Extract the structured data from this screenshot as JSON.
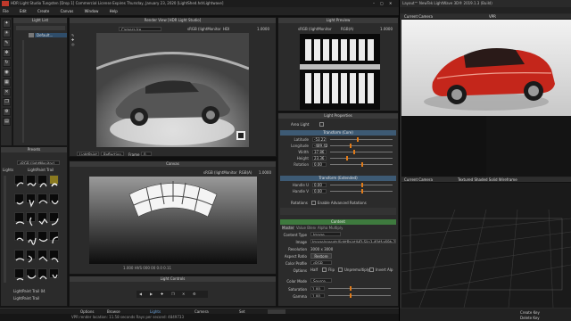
{
  "titlebar": {
    "title": "HDR Light Studio Tungsten [Drop 1] Commercial License Expires Thursday, January 23, 2020 [LightShed.hdrLightwave]"
  },
  "menubar": {
    "items": [
      "File",
      "Edit",
      "Create",
      "Canvas",
      "Window",
      "Help"
    ]
  },
  "light_list": {
    "title": "Light List",
    "row_label": "Default..."
  },
  "presets": {
    "title": "Presets",
    "tabs": [
      "Lights",
      "LightPaint Trail"
    ],
    "profile": "sRGB (lightMonitor)",
    "current": "LightPaint Trail 04",
    "footer": "LightPaint Trail"
  },
  "render_view": {
    "title": "Render View [HDR Light Studio]",
    "camera": "Camera.Ire",
    "cs": "sRGB (lightMonitor)",
    "mode": "HDI",
    "value": "1.0000",
    "tab": "LightPaint",
    "reflection": "Reflection",
    "frame_label": "Frame",
    "frame_value": "0"
  },
  "canvas": {
    "title": "Canvas",
    "cs": "sRGB (lightMonitor)",
    "mode": "RGB(A)",
    "value": "1.0000",
    "readout": "1.000  HVS 000 00 0.0 0.11",
    "controls_title": "Light Controls"
  },
  "preview": {
    "title": "Light Preview",
    "cs": "sRGB (lightMonitor)",
    "mode": "RGB(A)",
    "value": "1.0000"
  },
  "properties": {
    "title": "Light Properties",
    "area_light": "Area Light",
    "transform_title": "Transform (Core)",
    "core": [
      {
        "label": "Latitude",
        "value": "-53.22"
      },
      {
        "label": "Longitude",
        "value": "-489.42"
      },
      {
        "label": "Width",
        "value": "37.86"
      },
      {
        "label": "Height",
        "value": "23.36"
      },
      {
        "label": "Rotation",
        "value": "0.00"
      }
    ],
    "ext_title": "Transform (Extended)",
    "ext": [
      {
        "label": "Handle U",
        "value": "0.00"
      },
      {
        "label": "Handle V",
        "value": "0.00"
      }
    ],
    "rotations": "Rotations",
    "adv": "Enable Advanced Rotations",
    "content_title": "Content",
    "content_tabs": [
      "Master",
      "Value Blend",
      "Alpha Multiply"
    ],
    "content_type_label": "Content Type",
    "content_type": "Image",
    "image_label": "Image",
    "image_path": "Image/presets/lightPaint/HD-Silo3-40df-a69b-23f0ab4b90e6.f",
    "resolution_label": "Resolution",
    "resolution": "3000 x 3000",
    "aspect_label": "Aspect Ratio",
    "aspect_btn": "Restore",
    "profile_label": "Color Profile",
    "profile": "sRGB",
    "options_label": "Options",
    "opts": [
      "Half",
      "Flip",
      "Unpremultiply",
      "Invert Alp"
    ],
    "colormode_label": "Color Mode",
    "colormode": "Source",
    "sat_label": "Saturation",
    "sat": "1.00",
    "gamma_label": "Gamma",
    "gamma": "1.00"
  },
  "status": {
    "items": [
      "Options",
      "Browse",
      "Lights",
      "Camera",
      "Set"
    ],
    "text": "VPR render location: 11.58 seconds  Rays per second: 4849733"
  },
  "lightwave": {
    "title": "Layout™ NewTek LightWave 3D® 2019.1.3 (Build)",
    "cam": "Current Camera",
    "vpr": "VPR",
    "cam2": "Current Camera",
    "textured": "Textured Shaded Solid Wireframe",
    "bottom": [
      "Create Key",
      "Delete Key"
    ]
  }
}
